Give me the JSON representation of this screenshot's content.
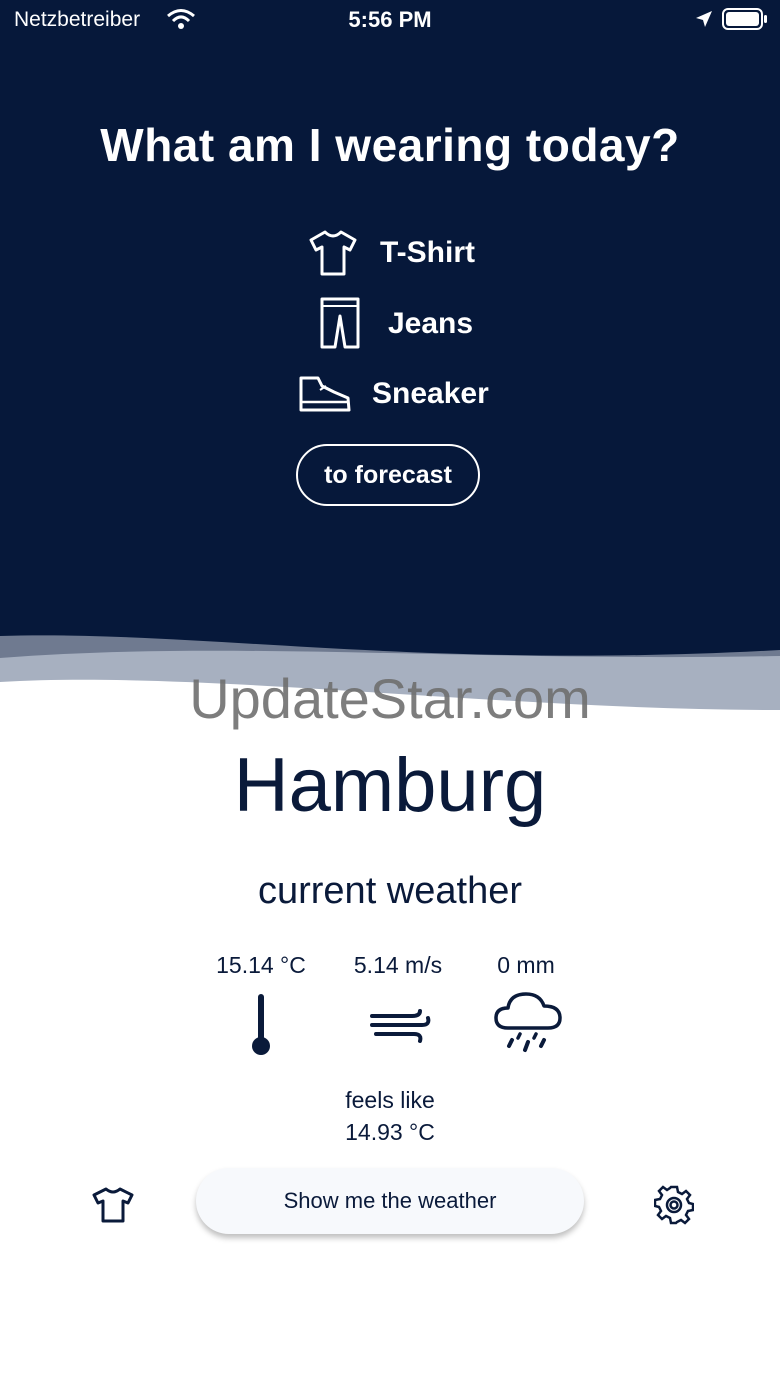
{
  "status_bar": {
    "carrier": "Netzbetreiber",
    "time": "5:56 PM"
  },
  "hero": {
    "title": "What am I wearing today?",
    "outfit": [
      {
        "label": "T-Shirt",
        "icon": "tshirt-icon"
      },
      {
        "label": "Jeans",
        "icon": "jeans-icon"
      },
      {
        "label": "Sneaker",
        "icon": "sneaker-icon"
      }
    ],
    "forecast_button": "to forecast"
  },
  "watermark": "UpdateStar.com",
  "weather": {
    "city": "Hamburg",
    "subtitle": "current weather",
    "temperature": "15.14 °C",
    "wind": "5.14 m/s",
    "precipitation": "0 mm",
    "feels_like_label": "feels like",
    "feels_like_value": "14.93 °C"
  },
  "bottom_bar": {
    "show_button": "Show me the weather",
    "left_icon": "tshirt-icon",
    "right_icon": "gear-icon"
  },
  "colors": {
    "hero_bg": "#06183a",
    "text_dark": "#0a1a3a",
    "wave_light": "#a7b0c0",
    "wave_mid": "#7c879b"
  }
}
